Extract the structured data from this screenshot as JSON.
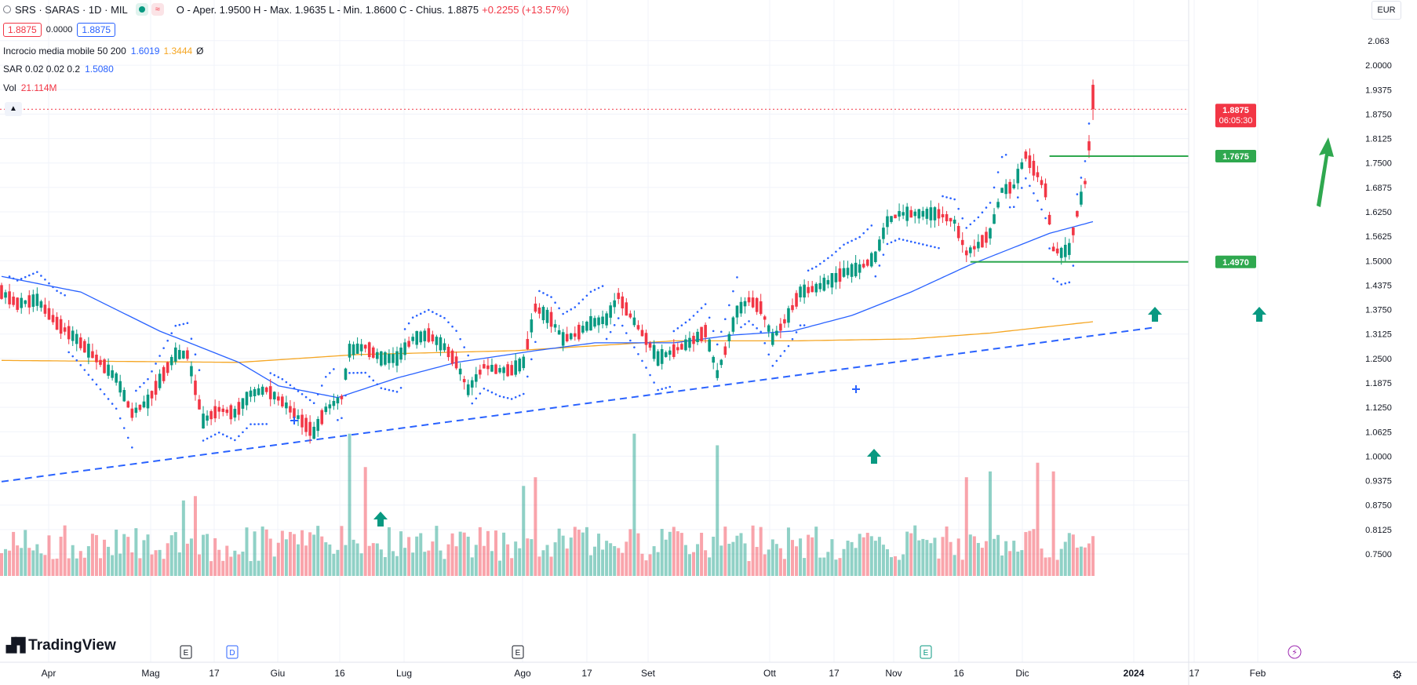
{
  "header": {
    "symbol_line": "SRS · SARAS · 1D · MIL",
    "ohlc": "O - Aper. 1.9500  H - Max. 1.9635  L - Min. 1.8600  C - Chius. 1.8875",
    "change": "+0.2255 (+13.57%)",
    "sell_price": "1.8875",
    "spread": "0.0000",
    "buy_price": "1.8875",
    "wave_icon": "≈"
  },
  "indicators": {
    "ma_cross": {
      "label": "Incrocio media mobile 50 200",
      "v1": "1.6019",
      "v2": "1.3444",
      "v3": "Ø"
    },
    "sar": {
      "label": "SAR 0.02 0.02 0.2",
      "value": "1.5080"
    },
    "vol": {
      "label": "Vol",
      "value": "21.114M"
    }
  },
  "currency": "EUR",
  "collapse_icon": "chevron-up-icon",
  "brand": "TradingView",
  "colors": {
    "up": "#089981",
    "down": "#f23645",
    "ma50": "#2962ff",
    "ma200": "#f5a623",
    "sar": "#2962ff",
    "levels": "#2fa84f",
    "grid": "#f0f3fa"
  },
  "chart_data": {
    "type": "candlestick",
    "title": "SRS · SARAS · 1D · MIL",
    "y_ticks": [
      "2.063",
      "2.0000",
      "1.9375",
      "1.8750",
      "1.8125",
      "1.7500",
      "1.6875",
      "1.6250",
      "1.5625",
      "1.5000",
      "1.4375",
      "1.3750",
      "1.3125",
      "1.2500",
      "1.1875",
      "1.1250",
      "1.0625",
      "1.0000",
      "0.9375",
      "0.8750",
      "0.8125",
      "0.7500"
    ],
    "x_ticks": [
      "Apr",
      "Mag",
      "17",
      "Giu",
      "16",
      "Lug",
      "Ago",
      "17",
      "Set",
      "Ott",
      "17",
      "Nov",
      "16",
      "Dic",
      "2024",
      "17",
      "Feb"
    ],
    "last_price_label": "1.8875",
    "countdown": "06:05:30",
    "level_labels": [
      "1.7675",
      "1.4970"
    ],
    "price_anchors": [
      [
        0,
        1.42
      ],
      [
        4,
        1.39
      ],
      [
        9,
        1.4
      ],
      [
        14,
        1.34
      ],
      [
        19,
        1.3
      ],
      [
        24,
        1.25
      ],
      [
        29,
        1.2
      ],
      [
        33,
        1.11
      ],
      [
        37,
        1.14
      ],
      [
        41,
        1.21
      ],
      [
        44,
        1.26
      ],
      [
        47,
        1.26
      ],
      [
        51,
        1.09
      ],
      [
        55,
        1.12
      ],
      [
        59,
        1.11
      ],
      [
        63,
        1.16
      ],
      [
        67,
        1.17
      ],
      [
        71,
        1.14
      ],
      [
        75,
        1.1
      ],
      [
        79,
        1.06
      ],
      [
        82,
        1.12
      ],
      [
        86,
        1.15
      ],
      [
        88,
        1.27
      ],
      [
        92,
        1.28
      ],
      [
        96,
        1.25
      ],
      [
        100,
        1.25
      ],
      [
        104,
        1.3
      ],
      [
        108,
        1.31
      ],
      [
        112,
        1.28
      ],
      [
        115,
        1.24
      ],
      [
        118,
        1.17
      ],
      [
        122,
        1.23
      ],
      [
        126,
        1.22
      ],
      [
        129,
        1.22
      ],
      [
        132,
        1.24
      ],
      [
        135,
        1.38
      ],
      [
        139,
        1.35
      ],
      [
        142,
        1.3
      ],
      [
        145,
        1.31
      ],
      [
        149,
        1.34
      ],
      [
        153,
        1.35
      ],
      [
        156,
        1.41
      ],
      [
        159,
        1.36
      ],
      [
        163,
        1.3
      ],
      [
        166,
        1.25
      ],
      [
        170,
        1.27
      ],
      [
        174,
        1.29
      ],
      [
        178,
        1.32
      ],
      [
        181,
        1.21
      ],
      [
        183,
        1.27
      ],
      [
        186,
        1.37
      ],
      [
        189,
        1.4
      ],
      [
        192,
        1.38
      ],
      [
        195,
        1.3
      ],
      [
        199,
        1.36
      ],
      [
        202,
        1.42
      ],
      [
        206,
        1.43
      ],
      [
        210,
        1.45
      ],
      [
        213,
        1.47
      ],
      [
        217,
        1.48
      ],
      [
        221,
        1.51
      ],
      [
        224,
        1.6
      ],
      [
        227,
        1.62
      ],
      [
        231,
        1.62
      ],
      [
        234,
        1.62
      ],
      [
        237,
        1.62
      ],
      [
        241,
        1.6
      ],
      [
        244,
        1.52
      ],
      [
        247,
        1.54
      ],
      [
        250,
        1.57
      ],
      [
        253,
        1.68
      ],
      [
        256,
        1.69
      ],
      [
        259,
        1.77
      ],
      [
        262,
        1.72
      ],
      [
        264,
        1.68
      ],
      [
        266,
        1.53
      ],
      [
        268,
        1.52
      ],
      [
        270,
        1.53
      ],
      [
        272,
        1.62
      ],
      [
        274,
        1.7
      ],
      [
        276,
        1.8875
      ]
    ],
    "last_candle": {
      "o": 1.95,
      "h": 1.9635,
      "l": 1.86,
      "c": 1.8875
    },
    "ma50_anchors": [
      [
        0,
        1.46
      ],
      [
        20,
        1.42
      ],
      [
        40,
        1.32
      ],
      [
        60,
        1.24
      ],
      [
        70,
        1.18
      ],
      [
        85,
        1.15
      ],
      [
        100,
        1.2
      ],
      [
        115,
        1.24
      ],
      [
        135,
        1.27
      ],
      [
        150,
        1.29
      ],
      [
        170,
        1.29
      ],
      [
        185,
        1.31
      ],
      [
        200,
        1.32
      ],
      [
        215,
        1.36
      ],
      [
        230,
        1.42
      ],
      [
        245,
        1.49
      ],
      [
        255,
        1.53
      ],
      [
        265,
        1.57
      ],
      [
        276,
        1.6
      ]
    ],
    "ma200_anchors": [
      [
        0,
        1.245
      ],
      [
        60,
        1.24
      ],
      [
        90,
        1.26
      ],
      [
        130,
        1.27
      ],
      [
        170,
        1.295
      ],
      [
        200,
        1.295
      ],
      [
        230,
        1.3
      ],
      [
        250,
        1.315
      ],
      [
        276,
        1.344
      ]
    ],
    "trendline": {
      "from": [
        0,
        0.935
      ],
      "to": [
        292,
        1.33
      ]
    },
    "levels": [
      1.7675,
      1.497
    ],
    "volume_max_label": "21.114M"
  }
}
